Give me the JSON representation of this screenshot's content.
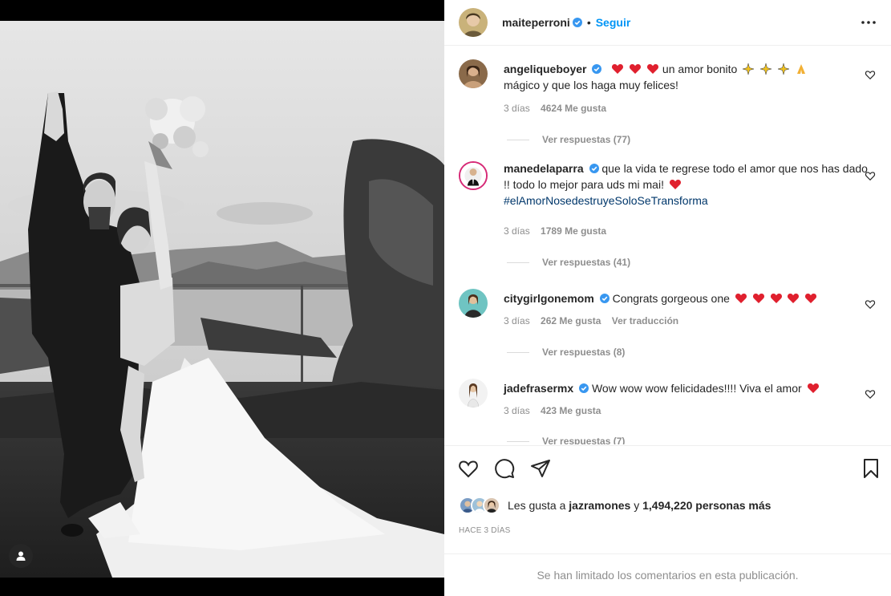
{
  "post": {
    "author": "maiteperroni",
    "follow_label": "Seguir",
    "separator": "•"
  },
  "comments": [
    {
      "user": "angeliqueboyer",
      "text": "un amor bonito",
      "text_line2": "mágico y que los haga muy felices!",
      "time": "3 días",
      "likes": "4624 Me gusta",
      "replies": "Ver respuestas (77)"
    },
    {
      "user": "manedelaparra",
      "text": "que la vida te regrese todo el amor que nos has dado !! todo lo mejor para uds mi mai!",
      "hashtag": "#elAmorNosedestruyeSoloSeTransforma",
      "time": "3 días",
      "likes": "1789 Me gusta",
      "replies": "Ver respuestas (41)"
    },
    {
      "user": "citygirlgonemom",
      "text": "Congrats gorgeous one",
      "time": "3 días",
      "likes": "262 Me gusta",
      "translate": "Ver traducción",
      "replies": "Ver respuestas (8)"
    },
    {
      "user": "jadefrasermx",
      "text": "Wow wow wow felicidades!!!! Viva el amor",
      "time": "3 días",
      "likes": "423 Me gusta",
      "replies": "Ver respuestas (7)"
    }
  ],
  "likes_bar": {
    "prefix": "Les gusta a",
    "first_liker": "jazramones",
    "conjunction": "y",
    "others": "1,494,220 personas más"
  },
  "time_ago": "HACE 3 DÍAS",
  "comments_limited": "Se han limitado los comentarios en esta publicación.",
  "colors": {
    "accent": "#0095f6",
    "verified": "#3897f0",
    "heart": "#ed4956",
    "hashtag": "#00376b",
    "muted": "#8e8e8e"
  },
  "icons": [
    "person-tag-icon",
    "verified-icon",
    "more-options-icon",
    "heart-icon",
    "comment-icon",
    "share-icon",
    "bookmark-icon"
  ]
}
